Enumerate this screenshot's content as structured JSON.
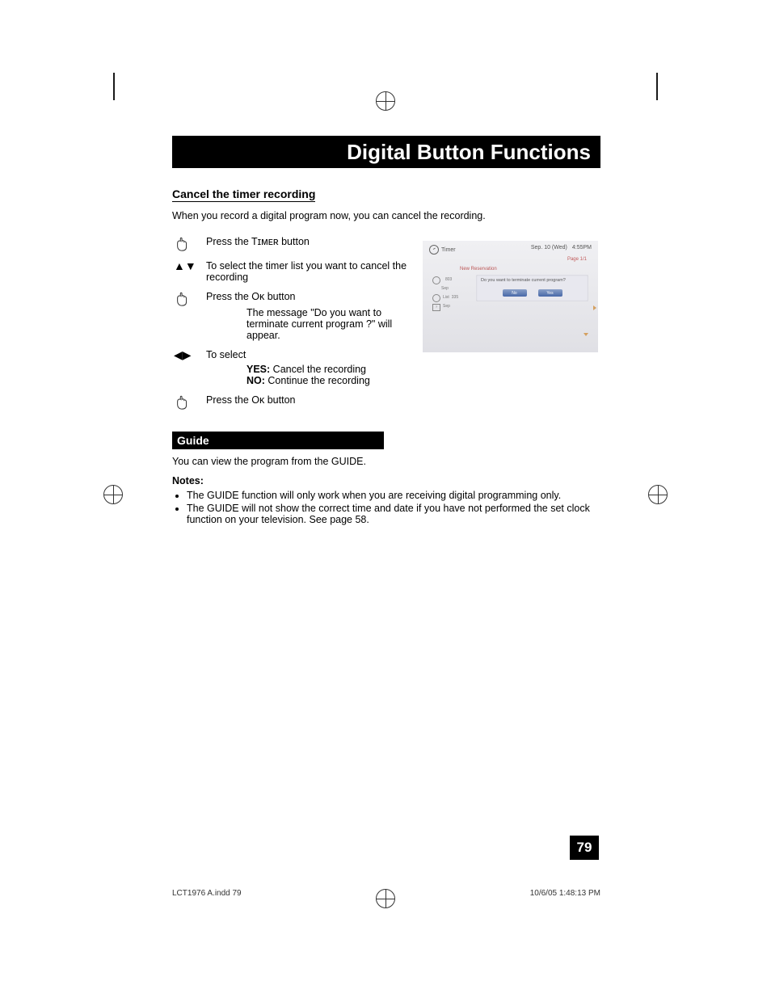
{
  "title": "Digital Button Functions",
  "section1": {
    "heading": "Cancel the timer recording",
    "intro": "When you record a digital program now, you can cancel the recording.",
    "step1": "Press the Tɪᴍᴇʀ button",
    "step2": "To select the timer list you want to cancel the recording",
    "step3": "Press the Oᴋ button",
    "step3_sub": "The message \"Do you want to terminate current program ?\" will appear.",
    "step4": "To select",
    "step4_yes_label": "YES:",
    "step4_yes_text": "  Cancel the recording",
    "step4_no_label": "NO:",
    "step4_no_text": "  Continue the recording",
    "step5": "Press the Oᴋ button"
  },
  "section2": {
    "heading": "Guide",
    "intro": "You can view the program from the GUIDE.",
    "notes_heading": "Notes:",
    "note1": "The GUIDE function will only work when you are receiving digital programming only.",
    "note2": "The GUIDE will not show the correct time and date if you have not performed the set clock function on your television.  See page 58."
  },
  "screenshot": {
    "timer_label": "Timer",
    "date": "Sep. 10 (Wed)",
    "time": "4:55PM",
    "page": "Page 1/1",
    "new_reservation": "New Reservation",
    "row1_a": "803",
    "row1_b": "Sep",
    "row2_pre": "List",
    "row2_a": "335",
    "row2_b": "Sep",
    "dialog_q": "Do you want to terminate current program?",
    "btn_no": "No",
    "btn_yes": "Yes"
  },
  "page_number": "79",
  "footer": {
    "left": "LCT1976 A.indd   79",
    "right": "10/6/05   1:48:13 PM"
  }
}
